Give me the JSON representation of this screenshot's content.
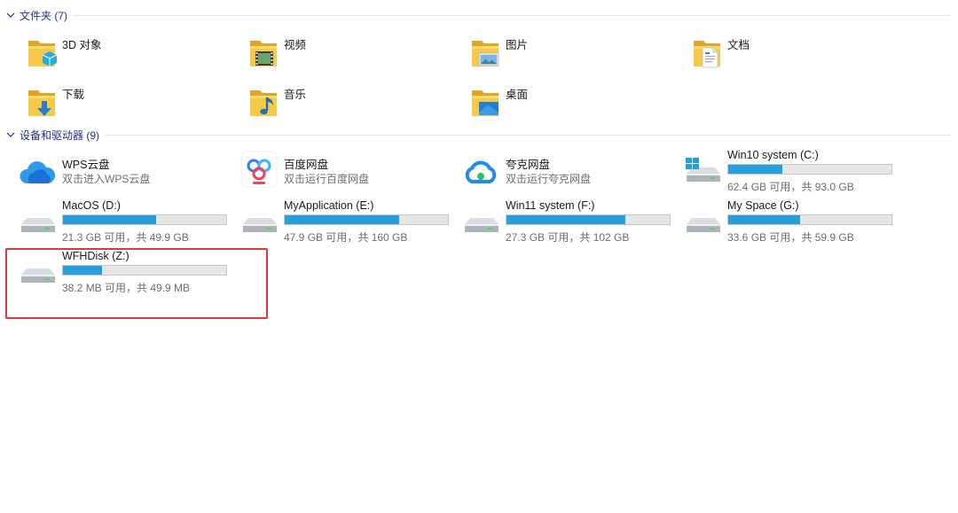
{
  "groups": {
    "folders": {
      "title": "文件夹 (7)"
    },
    "devices": {
      "title": "设备和驱动器 (9)"
    }
  },
  "folders": [
    {
      "label": "3D 对象",
      "icon": "folder-3d-objects-icon"
    },
    {
      "label": "视频",
      "icon": "folder-videos-icon"
    },
    {
      "label": "图片",
      "icon": "folder-pictures-icon"
    },
    {
      "label": "文档",
      "icon": "folder-documents-icon"
    },
    {
      "label": "下载",
      "icon": "folder-downloads-icon"
    },
    {
      "label": "音乐",
      "icon": "folder-music-icon"
    },
    {
      "label": "桌面",
      "icon": "folder-desktop-icon"
    }
  ],
  "cloud": [
    {
      "name": "WPS云盘",
      "subtitle": "双击进入WPS云盘",
      "icon": "wps-cloud-icon"
    },
    {
      "name": "百度网盘",
      "subtitle": "双击运行百度网盘",
      "icon": "baidu-netdisk-icon"
    },
    {
      "name": "夸克网盘",
      "subtitle": "双击运行夸克网盘",
      "icon": "quark-netdisk-icon"
    }
  ],
  "drives": [
    {
      "name": "Win10 system (C:)",
      "space": "62.4 GB 可用，共 93.0 GB",
      "used_fraction": 0.33,
      "icon": "windows-drive-icon"
    },
    {
      "name": "MacOS (D:)",
      "space": "21.3 GB 可用，共 49.9 GB",
      "used_fraction": 0.57,
      "icon": "hard-drive-icon"
    },
    {
      "name": "MyApplication (E:)",
      "space": "47.9 GB 可用，共 160 GB",
      "used_fraction": 0.7,
      "icon": "hard-drive-icon"
    },
    {
      "name": "Win11 system (F:)",
      "space": "27.3 GB 可用，共 102 GB",
      "used_fraction": 0.73,
      "icon": "hard-drive-icon"
    },
    {
      "name": "My Space (G:)",
      "space": "33.6 GB 可用，共 59.9 GB",
      "used_fraction": 0.44,
      "icon": "hard-drive-icon"
    },
    {
      "name": "WFHDisk (Z:)",
      "space": "38.2 MB 可用，共 49.9 MB",
      "used_fraction": 0.24,
      "icon": "hard-drive-icon"
    }
  ],
  "colors": {
    "header_text": "#1e3287",
    "bar_fill": "#26a0da",
    "bar_track": "#e6e6e6",
    "highlight": "#e53535",
    "folder": "#f5c54a"
  }
}
